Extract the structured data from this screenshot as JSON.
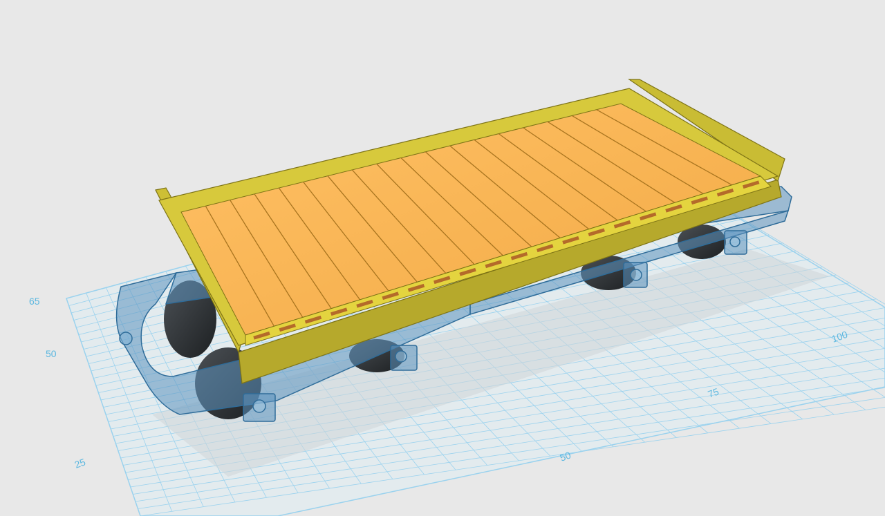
{
  "viewport": {
    "background": "#e8e8e8",
    "grid_color": "#8fd0ee",
    "grid_fill": "#e3ebee"
  },
  "grid_labels": {
    "left": [
      "65",
      "50",
      "25"
    ],
    "bottom": [
      "50",
      "75",
      "100"
    ]
  },
  "model": {
    "deck_color": "#f8b654",
    "frame_color": "#d7c93c",
    "chassis_color": "#4f89b6",
    "wheel_color": "#2e3236"
  }
}
